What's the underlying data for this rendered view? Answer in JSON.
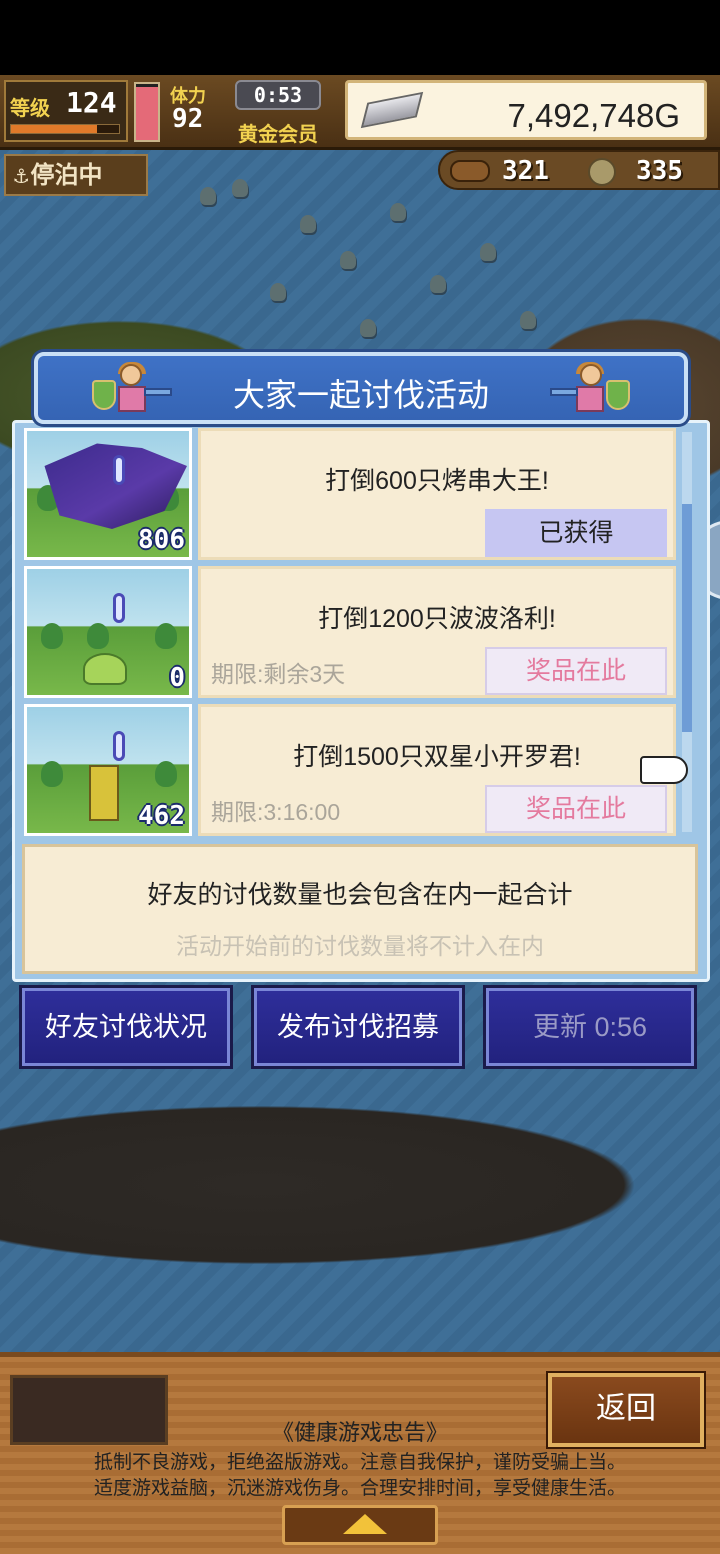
{
  "hud": {
    "level_label": "等级",
    "level_value": "124",
    "level_progress": 0.8,
    "stamina_label": "体力",
    "stamina_value": "92",
    "stamina_fill": 0.95,
    "timer": "0:53",
    "membership": "黄金会员",
    "money": "7,492,748G",
    "status_badge": "停泊中",
    "wood": "321",
    "coins": "335"
  },
  "dialog": {
    "title": "大家一起讨伐活动",
    "events": [
      {
        "target": "打倒600只烤串大王!",
        "count": "806",
        "deadline": "",
        "button": "已获得",
        "state": "obtained"
      },
      {
        "target": "打倒1200只波波洛利!",
        "count": "0",
        "deadline": "期限:剩余3天",
        "button": "奖品在此",
        "state": "prize"
      },
      {
        "target": "打倒1500只双星小开罗君!",
        "count": "462",
        "deadline": "期限:3:16:00",
        "button": "奖品在此",
        "state": "prize"
      }
    ],
    "scroll": {
      "position": 0.42,
      "visible_fraction": 0.57
    },
    "info_line1": "好友的讨伐数量也会包含在内一起合计",
    "info_line2": "活动开始前的讨伐数量将不计入在内"
  },
  "buttons": {
    "friends": "好友讨伐状况",
    "recruit": "发布讨伐招募",
    "refresh": "更新 0:56"
  },
  "footer": {
    "back": "返回",
    "notice_title": "《健康游戏忠告》",
    "notice_line1": "抵制不良游戏，拒绝盗版游戏。注意自我保护，谨防受骗上当。",
    "notice_line2": "适度游戏益脑，沉迷游戏伤身。合理安排时间，享受健康生活。"
  },
  "colors": {
    "dialog_blue": "#3564b4",
    "card_cream": "#f7ecd4",
    "prize_pink": "#e47a9e",
    "button_navy": "#22227e"
  }
}
